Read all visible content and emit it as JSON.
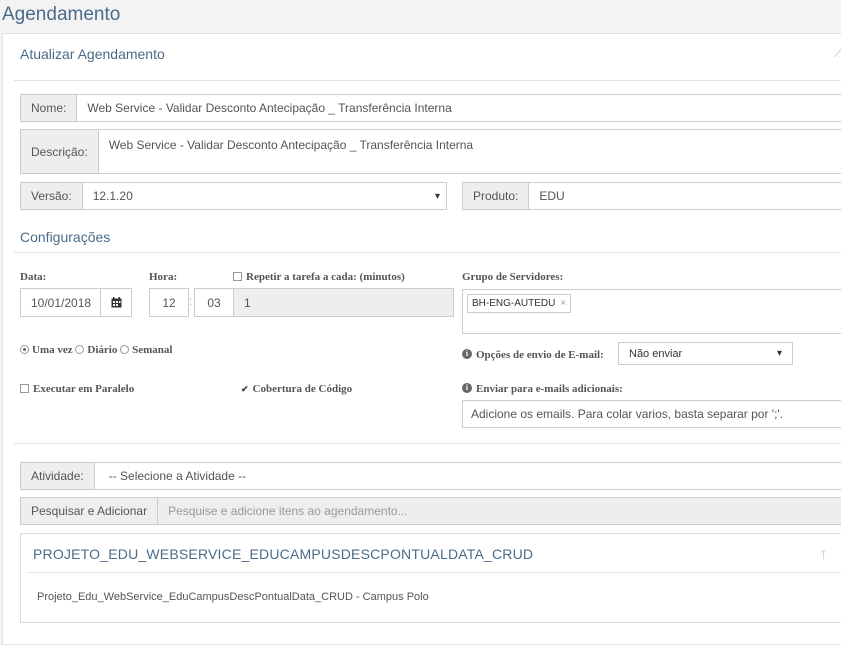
{
  "page": {
    "title": "Agendamento"
  },
  "form": {
    "section_title": "Atualizar Agendamento",
    "nome": {
      "label": "Nome:",
      "value": "Web Service - Validar Desconto Antecipação _ Transferência Interna"
    },
    "descricao": {
      "label": "Descrição:",
      "value": "Web Service - Validar Desconto Antecipação _ Transferência Interna"
    },
    "versao": {
      "label": "Versão:",
      "value": "12.1.20"
    },
    "produto": {
      "label": "Produto:",
      "value": "EDU"
    }
  },
  "config": {
    "title": "Configurações",
    "data_label": "Data:",
    "data_value": "10/01/2018",
    "hora_label": "Hora:",
    "hora_h": "12",
    "hora_sep": ":",
    "hora_m": "03",
    "repetir_label": "Repetir a tarefa a cada: (minutos)",
    "repetir_value": "1",
    "grupo_label": "Grupo de Servidores:",
    "grupo_tag": "BH-ENG-AUTEDU",
    "freq": [
      "Uma vez",
      "Diário",
      "Semanal"
    ],
    "email_opts_label": "Opções de envio de E-mail:",
    "email_opts_value": "Não enviar",
    "paralelo_label": "Executar em Paralelo",
    "cobertura_label": "Cobertura de Código",
    "emails_label": "Enviar para e-mails adicionais:",
    "emails_placeholder": "Adicione os emails. Para colar varios, basta separar por ';'."
  },
  "atividade": {
    "label": "Atividade:",
    "value": "-- Selecione a Atividade --"
  },
  "search": {
    "button": "Pesquisar e Adicionar",
    "placeholder": "Pesquise e adicione itens ao agendamento..."
  },
  "project": {
    "title": "PROJETO_EDU_WEBSERVICE_EDUCAMPUSDESCPONTUALDATA_CRUD",
    "item": "Projeto_Edu_WebService_EduCampusDescPontualData_CRUD - Campus Polo"
  },
  "icons": {
    "calendar": "calendar-icon",
    "remove": "×",
    "dropdown": "▾",
    "info": "i",
    "arrow_up": "arrow-up-icon",
    "collapse": "pencil-icon"
  }
}
